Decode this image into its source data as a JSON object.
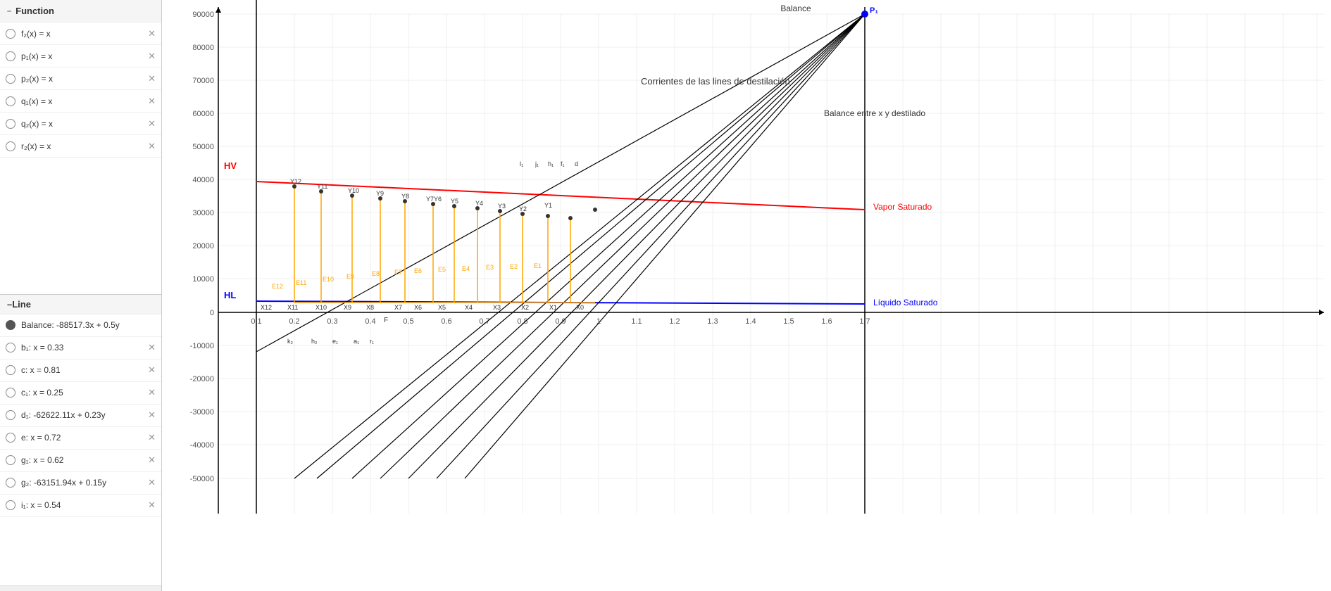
{
  "leftPanel": {
    "functionHeader": "Function",
    "lineHeader": "Line",
    "functions": [
      {
        "id": "f2",
        "label": "f₂(x) = x",
        "radio": false,
        "hasClose": true
      },
      {
        "id": "p1",
        "label": "p₁(x) = x",
        "radio": false,
        "hasClose": true
      },
      {
        "id": "p2",
        "label": "p₂(x) = x",
        "radio": false,
        "hasClose": true
      },
      {
        "id": "q1",
        "label": "q₁(x) = x",
        "radio": false,
        "hasClose": true
      },
      {
        "id": "q2",
        "label": "q₂(x) = x",
        "radio": false,
        "hasClose": true
      },
      {
        "id": "r2",
        "label": "r₂(x) = x",
        "radio": false,
        "hasClose": true
      }
    ],
    "lines": [
      {
        "id": "balance",
        "label": "Balance: -88517.3x + 0.5y",
        "radio": true,
        "hasClose": false,
        "filled": true
      },
      {
        "id": "b1",
        "label": "b₁: x = 0.33",
        "radio": false,
        "hasClose": true
      },
      {
        "id": "c",
        "label": "c: x = 0.81",
        "radio": false,
        "hasClose": true
      },
      {
        "id": "c1",
        "label": "c₁: x = 0.25",
        "radio": false,
        "hasClose": true
      },
      {
        "id": "d1",
        "label": "d₁: -62622.11x + 0.23y",
        "radio": false,
        "hasClose": true
      },
      {
        "id": "e",
        "label": "e: x = 0.72",
        "radio": false,
        "hasClose": true
      },
      {
        "id": "g1",
        "label": "g₁: x = 0.62",
        "radio": false,
        "hasClose": true
      },
      {
        "id": "g2",
        "label": "g₂: -63151.94x + 0.15y",
        "radio": false,
        "hasClose": true
      },
      {
        "id": "i1",
        "label": "i₁: x = 0.54",
        "radio": false,
        "hasClose": true
      }
    ]
  },
  "chart": {
    "title": "Balance",
    "annotations": {
      "corrientes": "Corrientes de las lines de destilación",
      "balanceLabel": "Balance entre x y destilado",
      "HV": "HV",
      "HL": "HL",
      "vaporSaturado": "Vapor Saturado",
      "liquidoSaturado": "Líquido Saturado",
      "P1": "P₁"
    },
    "yAxis": {
      "min": -50000,
      "max": 90000,
      "step": 10000
    },
    "xAxis": {
      "min": 0,
      "max": 1.7,
      "step": 0.1
    }
  }
}
